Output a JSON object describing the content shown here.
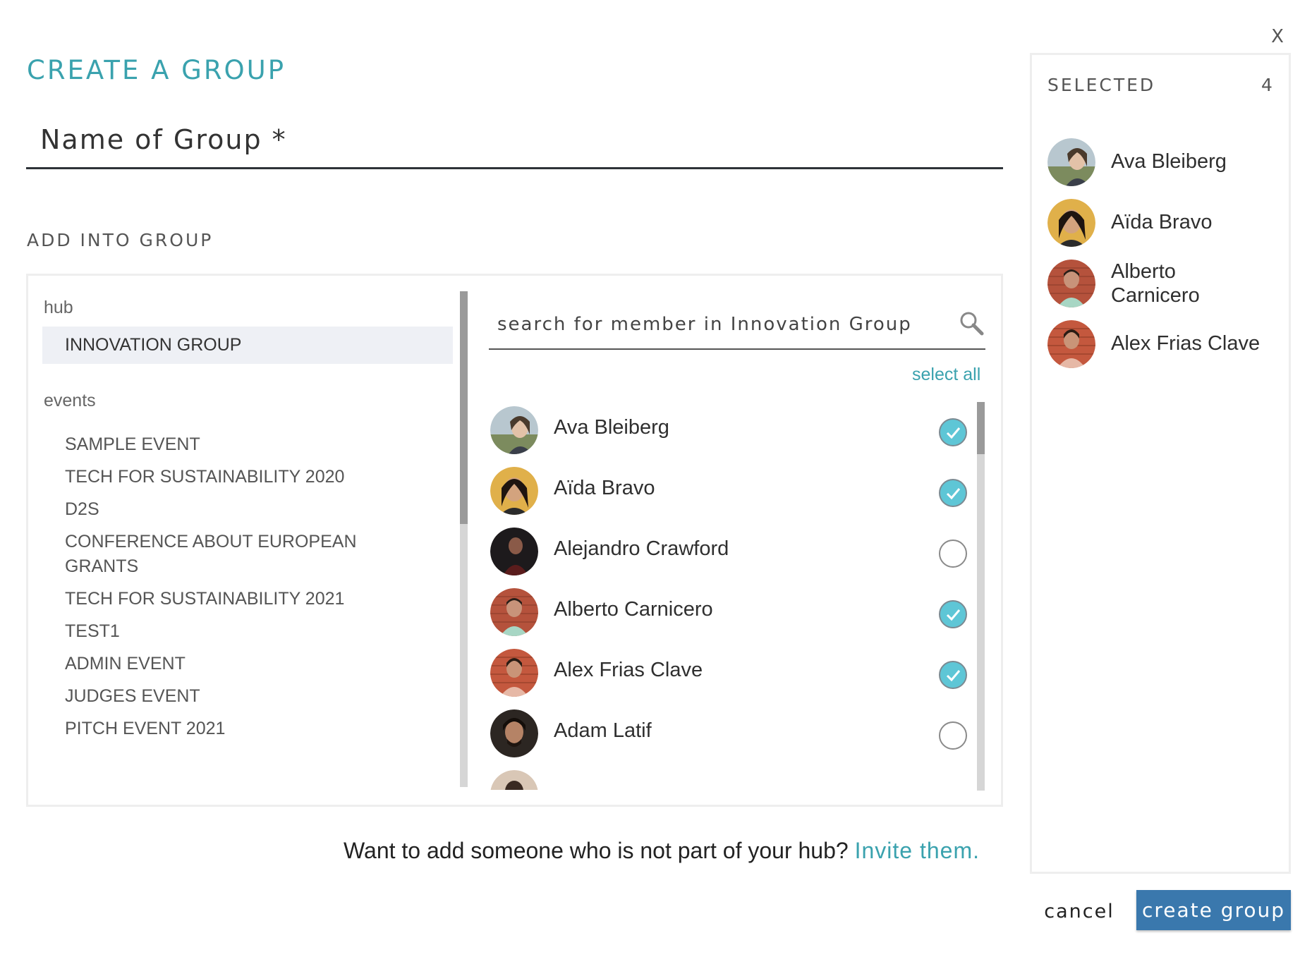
{
  "close_label": "X",
  "header": {
    "title": "CREATE A GROUP",
    "name_placeholder": "Name of Group *",
    "add_label": "ADD INTO GROUP"
  },
  "nav": {
    "hub_label": "hub",
    "hub_items": [
      "INNOVATION GROUP"
    ],
    "events_label": "events",
    "event_items": [
      "SAMPLE EVENT",
      "TECH FOR SUSTAINABILITY 2020",
      "D2S",
      "CONFERENCE ABOUT EUROPEAN GRANTS",
      "TECH FOR SUSTAINABILITY 2021",
      "TEST1",
      "ADMIN EVENT",
      "JUDGES EVENT",
      "PITCH EVENT 2021"
    ]
  },
  "search": {
    "placeholder": "search for member in Innovation Group",
    "icon": "search-icon"
  },
  "select_all_label": "select all",
  "members": [
    {
      "name": "Ava Bleiberg",
      "selected": true
    },
    {
      "name": "Aïda Bravo",
      "selected": true
    },
    {
      "name": "Alejandro Crawford",
      "selected": false
    },
    {
      "name": "Alberto Carnicero",
      "selected": true
    },
    {
      "name": "Alex Frias Clave",
      "selected": true
    },
    {
      "name": "Adam Latif",
      "selected": false
    }
  ],
  "invite": {
    "text": "Want to add someone who is not part of your hub?",
    "link": "Invite them."
  },
  "selected_panel": {
    "title": "SELECTED",
    "count": "4",
    "items": [
      {
        "name_lines": [
          "Ava Bleiberg"
        ]
      },
      {
        "name_lines": [
          "Aïda Bravo"
        ]
      },
      {
        "name_lines": [
          "Alberto",
          "Carnicero"
        ]
      },
      {
        "name_lines": [
          "Alex Frias Clave"
        ]
      }
    ]
  },
  "buttons": {
    "cancel": "cancel",
    "create": "create group"
  },
  "colors": {
    "accent": "#3aa2ae",
    "primary_button": "#3a78ad",
    "check_on": "#5ec6d6"
  }
}
